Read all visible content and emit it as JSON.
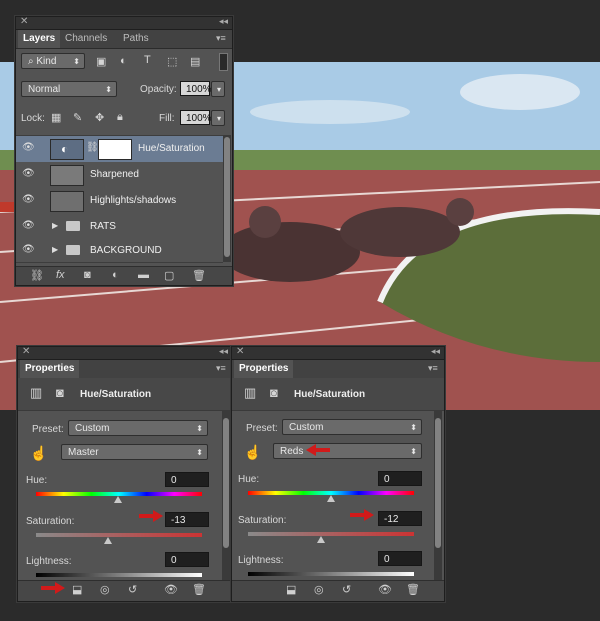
{
  "layers_panel": {
    "tabs": [
      "Layers",
      "Channels",
      "Paths"
    ],
    "filter": "Kind",
    "blend_mode": "Normal",
    "opacity_label": "Opacity:",
    "opacity_value": "100%",
    "lock_label": "Lock:",
    "fill_label": "Fill:",
    "fill_value": "100%",
    "layers": [
      {
        "name": "Hue/Saturation"
      },
      {
        "name": "Sharpened"
      },
      {
        "name": "Highlights/shadows"
      },
      {
        "name": "RATS"
      },
      {
        "name": "BACKGROUND"
      }
    ]
  },
  "properties_left": {
    "tab": "Properties",
    "title": "Hue/Saturation",
    "preset_label": "Preset:",
    "preset_value": "Custom",
    "channel_value": "Master",
    "hue_label": "Hue:",
    "hue_value": "0",
    "saturation_label": "Saturation:",
    "saturation_value": "-13",
    "lightness_label": "Lightness:",
    "lightness_value": "0"
  },
  "properties_right": {
    "tab": "Properties",
    "title": "Hue/Saturation",
    "preset_label": "Preset:",
    "preset_value": "Custom",
    "channel_value": "Reds",
    "hue_label": "Hue:",
    "hue_value": "0",
    "saturation_label": "Saturation:",
    "saturation_value": "-12",
    "lightness_label": "Lightness:",
    "lightness_value": "0"
  },
  "colors": {
    "panel_bg": "#535353",
    "selected_layer": "#6b7c93",
    "annotation_arrow": "#d11a1a"
  }
}
